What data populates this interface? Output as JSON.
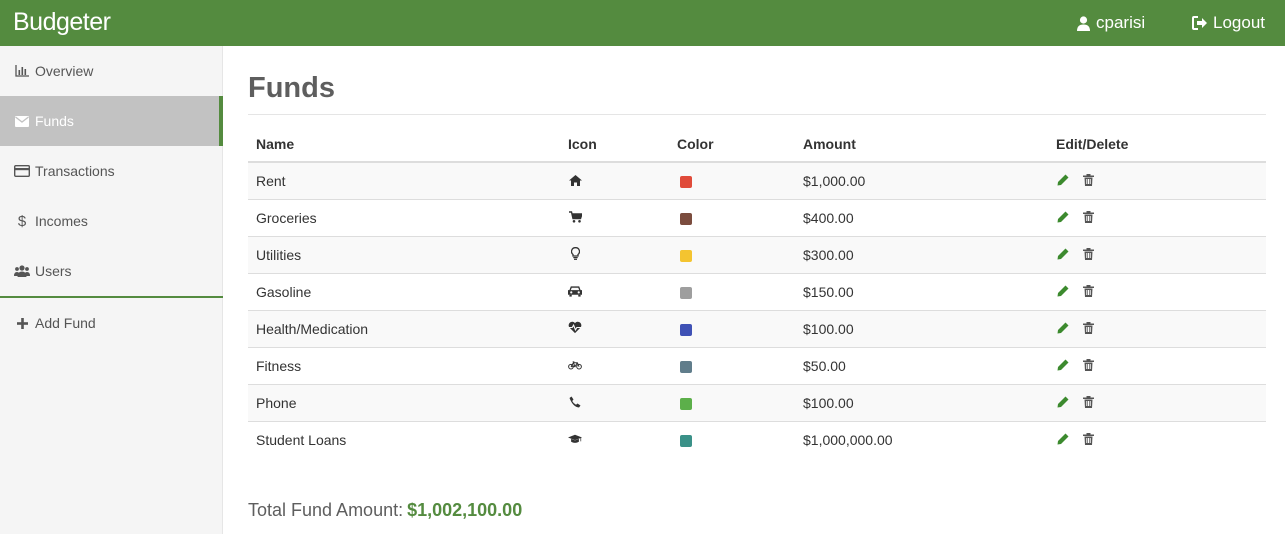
{
  "app": {
    "brand": "Budgeter"
  },
  "header": {
    "user": "cparisi",
    "logout_label": "Logout"
  },
  "sidebar": {
    "items": [
      {
        "label": "Overview",
        "icon": "bar-chart-icon",
        "active": false
      },
      {
        "label": "Funds",
        "icon": "envelope-icon",
        "active": true
      },
      {
        "label": "Transactions",
        "icon": "credit-card-icon",
        "active": false
      },
      {
        "label": "Incomes",
        "icon": "dollar-icon",
        "active": false
      },
      {
        "label": "Users",
        "icon": "users-icon",
        "active": false
      }
    ],
    "add_fund_label": "Add Fund"
  },
  "main": {
    "title": "Funds",
    "columns": [
      "Name",
      "Icon",
      "Color",
      "Amount",
      "Edit/Delete"
    ],
    "rows": [
      {
        "name": "Rent",
        "icon": "home-icon",
        "color": "#e04b3a",
        "amount": "$1,000.00"
      },
      {
        "name": "Groceries",
        "icon": "shopping-cart-icon",
        "color": "#7b4c3e",
        "amount": "$400.00"
      },
      {
        "name": "Utilities",
        "icon": "lightbulb-icon",
        "color": "#f4c430",
        "amount": "$300.00"
      },
      {
        "name": "Gasoline",
        "icon": "car-icon",
        "color": "#9e9e9e",
        "amount": "$150.00"
      },
      {
        "name": "Health/Medication",
        "icon": "heartbeat-icon",
        "color": "#3f51b5",
        "amount": "$100.00"
      },
      {
        "name": "Fitness",
        "icon": "bicycle-icon",
        "color": "#607d8b",
        "amount": "$50.00"
      },
      {
        "name": "Phone",
        "icon": "phone-icon",
        "color": "#5caf4a",
        "amount": "$100.00"
      },
      {
        "name": "Student Loans",
        "icon": "graduation-cap-icon",
        "color": "#3a9188",
        "amount": "$1,000,000.00"
      }
    ],
    "total_label": "Total Fund Amount:",
    "total_value": "$1,002,100.00"
  },
  "colors": {
    "brand_green": "#548b3f",
    "edit_green": "#3c8a2e",
    "delete_gray": "#555555"
  }
}
